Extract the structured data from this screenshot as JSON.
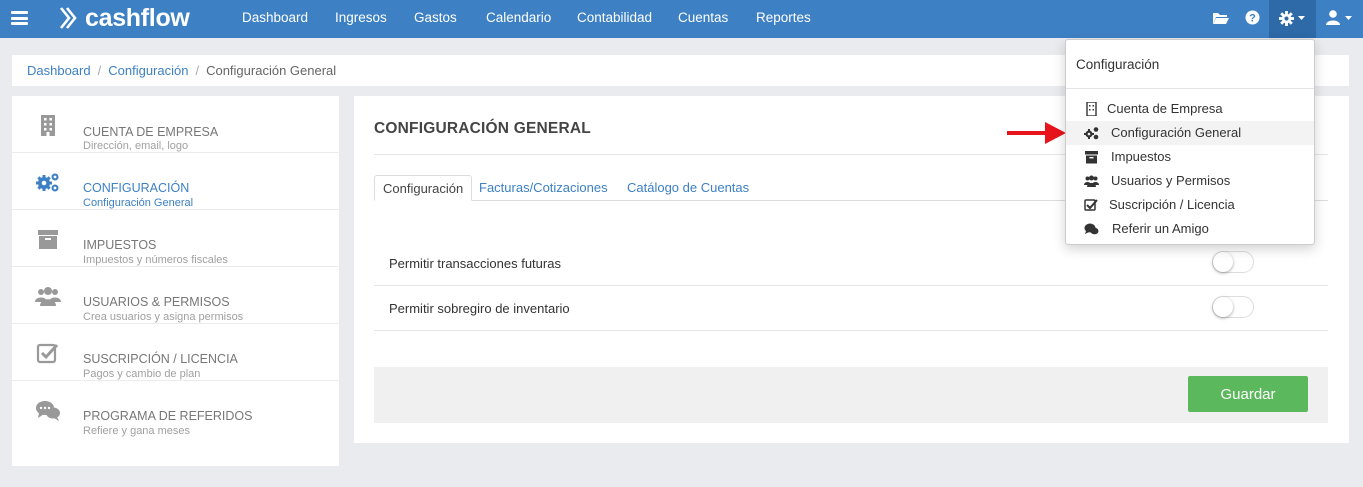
{
  "brand": {
    "name": "cashflow"
  },
  "nav": {
    "items": [
      "Dashboard",
      "Ingresos",
      "Gastos",
      "Calendario",
      "Contabilidad",
      "Cuentas",
      "Reportes"
    ],
    "right_icons": [
      "folder-icon",
      "help-icon",
      "gear-icon",
      "user-icon"
    ]
  },
  "breadcrumb": {
    "items": [
      "Dashboard",
      "Configuración"
    ],
    "current": "Configuración General"
  },
  "sidebar": {
    "items": [
      {
        "title": "CUENTA DE EMPRESA",
        "subtitle": "Dirección, email, logo",
        "icon": "building-icon"
      },
      {
        "title": "CONFIGURACIÓN",
        "subtitle": "Configuración General",
        "icon": "gears-icon",
        "active": true
      },
      {
        "title": "IMPUESTOS",
        "subtitle": "Impuestos y números fiscales",
        "icon": "archive-icon"
      },
      {
        "title": "USUARIOS & PERMISOS",
        "subtitle": "Crea usuarios y asigna permisos",
        "icon": "users-icon"
      },
      {
        "title": "SUSCRIPCIÓN / LICENCIA",
        "subtitle": "Pagos y cambio de plan",
        "icon": "checkbox-icon"
      },
      {
        "title": "PROGRAMA DE REFERIDOS",
        "subtitle": "Refiere y gana meses",
        "icon": "chat-icon"
      }
    ]
  },
  "main": {
    "title": "CONFIGURACIÓN GENERAL",
    "tabs": [
      "Configuración",
      "Facturas/Cotizaciones",
      "Catálogo de Cuentas"
    ],
    "settings": [
      {
        "label": "Permitir transacciones futuras",
        "enabled": false
      },
      {
        "label": "Permitir sobregiro de inventario",
        "enabled": false
      }
    ],
    "save_label": "Guardar"
  },
  "dropdown": {
    "header": "Configuración",
    "items": [
      {
        "label": "Cuenta de Empresa",
        "icon": "building-icon"
      },
      {
        "label": "Configuración General",
        "icon": "gears-icon",
        "highlighted": true
      },
      {
        "label": "Impuestos",
        "icon": "archive-icon"
      },
      {
        "label": "Usuarios y Permisos",
        "icon": "users-icon"
      },
      {
        "label": "Suscripción / Licencia",
        "icon": "checkbox-icon"
      },
      {
        "label": "Referir un Amigo",
        "icon": "chat-icon"
      }
    ]
  },
  "colors": {
    "primary": "#3d80c4",
    "nav_active": "#2e6aa8",
    "success": "#5cb85c",
    "annotation_arrow": "#e8141b"
  }
}
